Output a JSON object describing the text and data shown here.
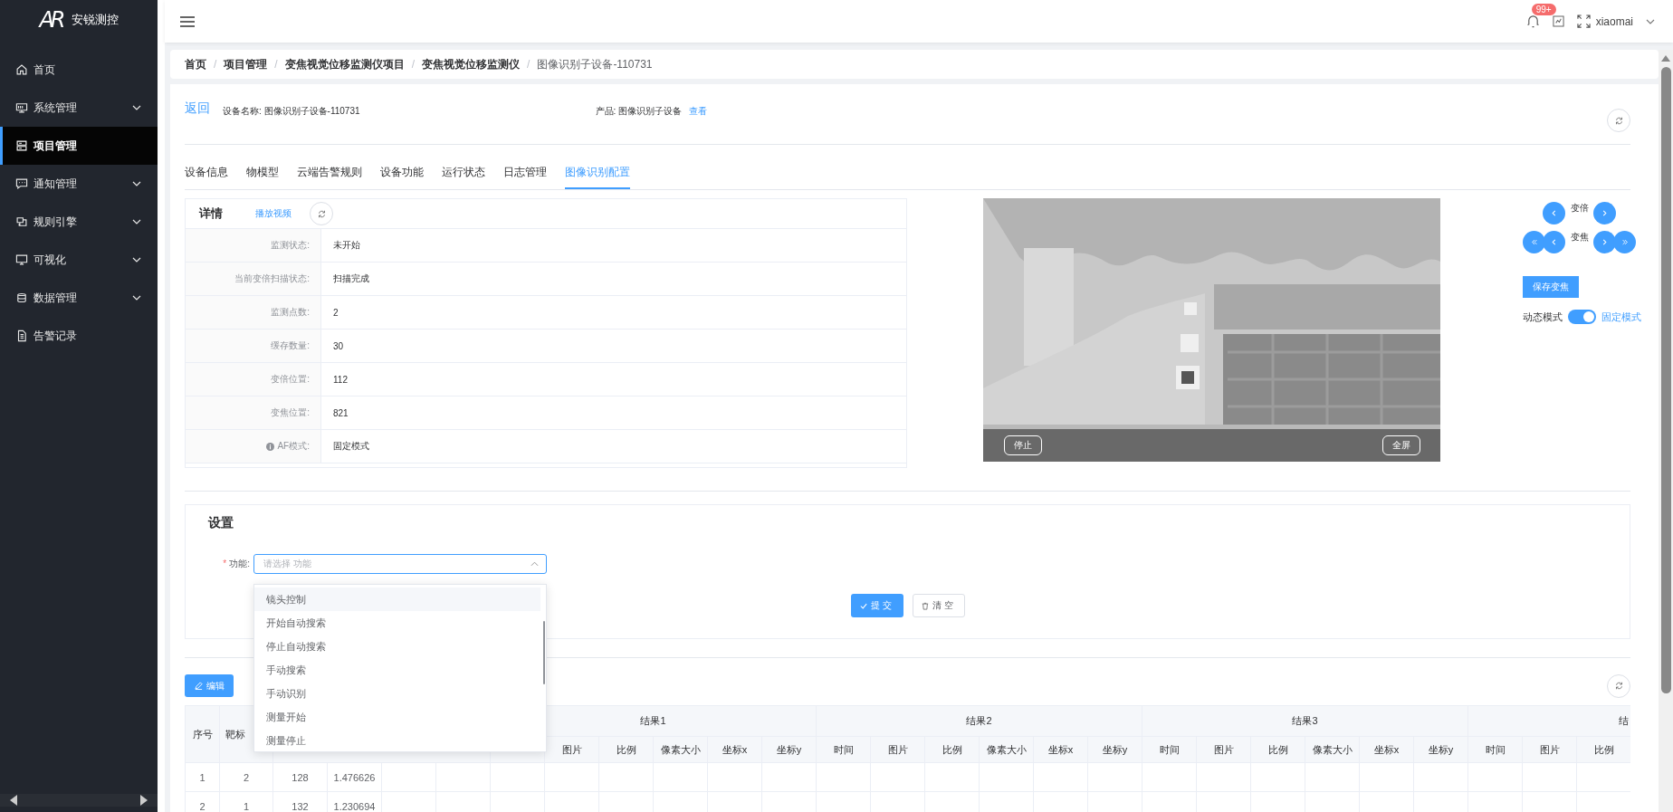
{
  "app": {
    "logo": "AR",
    "brand": "安锐测控"
  },
  "sidebar": {
    "items": [
      {
        "label": "首页",
        "kind": "link",
        "selected": false
      },
      {
        "label": "系统管理",
        "kind": "group",
        "expanded": false,
        "selected": false
      },
      {
        "label": "项目管理",
        "kind": "link",
        "selected": true
      },
      {
        "label": "通知管理",
        "kind": "group",
        "expanded": false,
        "selected": false
      },
      {
        "label": "规则引擎",
        "kind": "group",
        "expanded": false,
        "selected": false
      },
      {
        "label": "可视化",
        "kind": "group",
        "expanded": false,
        "selected": false
      },
      {
        "label": "数据管理",
        "kind": "group",
        "expanded": false,
        "selected": false
      },
      {
        "label": "告警记录",
        "kind": "link",
        "selected": false
      }
    ]
  },
  "header": {
    "notification_badge": "99+",
    "user": "xiaomai"
  },
  "breadcrumb_separator": "/",
  "breadcrumb": [
    {
      "label": "首页",
      "current": false
    },
    {
      "label": "项目管理",
      "current": false
    },
    {
      "label": "变焦视觉位移监测仪项目",
      "current": false
    },
    {
      "label": "变焦视觉位移监测仪",
      "current": false
    },
    {
      "label": "图像识别子设备-110731",
      "current": true
    }
  ],
  "device": {
    "back": "返回",
    "name": "设备名称: 图像识别子设备-110731",
    "product": "产品: 图像识别子设备",
    "view_link": "查看"
  },
  "tabs": [
    {
      "label": "设备信息",
      "selected": false
    },
    {
      "label": "物模型",
      "selected": false
    },
    {
      "label": "云端告警规则",
      "selected": false
    },
    {
      "label": "设备功能",
      "selected": false
    },
    {
      "label": "运行状态",
      "selected": false
    },
    {
      "label": "日志管理",
      "selected": false
    },
    {
      "label": "图像识别配置",
      "selected": true
    }
  ],
  "detail": {
    "title": "详情",
    "play_link": "播放视频",
    "rows": [
      {
        "label": "监测状态:",
        "value": "未开始",
        "kind": "plain"
      },
      {
        "label": "当前变倍扫描状态:",
        "value": "扫描完成",
        "kind": "plain"
      },
      {
        "label": "监测点数:",
        "value": "2",
        "kind": "plain"
      },
      {
        "label": "缓存数量:",
        "value": "30",
        "kind": "plain"
      },
      {
        "label": "变倍位置:",
        "value": "112",
        "kind": "plain"
      },
      {
        "label": "变焦位置:",
        "value": "821",
        "kind": "plain"
      },
      {
        "label": "AF模式:",
        "value": "固定模式",
        "kind": "info"
      }
    ]
  },
  "video": {
    "kind": "picture",
    "stop": "停止",
    "fullscreen": "全屏"
  },
  "lens": {
    "zoom_label": "变倍",
    "focus_label": "变焦",
    "save": "保存变焦",
    "mode_switch": {
      "off_label": "动态模式",
      "on_label": "固定模式",
      "on": true
    }
  },
  "settings": {
    "title": "设置",
    "field_label": "功能:",
    "required_mark": "*",
    "placeholder": "请选择 功能",
    "open": true,
    "options": [
      {
        "label": "镜头控制",
        "selected": true
      },
      {
        "label": "开始自动搜索",
        "selected": false
      },
      {
        "label": "停止自动搜索",
        "selected": false
      },
      {
        "label": "手动搜索",
        "selected": false
      },
      {
        "label": "手动识别",
        "selected": false
      },
      {
        "label": "测量开始",
        "selected": false
      },
      {
        "label": "测量停止",
        "selected": false
      }
    ],
    "submit": "提交",
    "reset": "清空"
  },
  "results": {
    "edit": "编辑",
    "header_columns": [
      "序号",
      "靶标"
    ],
    "groups": [
      {
        "title": "结果1",
        "columns": [
          "图片",
          "比例",
          "像素大小",
          "坐标x",
          "坐标y"
        ]
      },
      {
        "title": "结果2",
        "columns": [
          "时间",
          "图片",
          "比例",
          "像素大小",
          "坐标x",
          "坐标y"
        ]
      },
      {
        "title": "结果3",
        "columns": [
          "时间",
          "图片",
          "比例",
          "像素大小",
          "坐标x",
          "坐标y"
        ]
      },
      {
        "title": "结",
        "columns": [
          "时间",
          "图片",
          "比例"
        ]
      }
    ],
    "rows": [
      {
        "cells": [
          "1",
          "2",
          "128",
          "1.476626"
        ]
      },
      {
        "cells": [
          "2",
          "1",
          "132",
          "1.230694"
        ]
      }
    ]
  }
}
